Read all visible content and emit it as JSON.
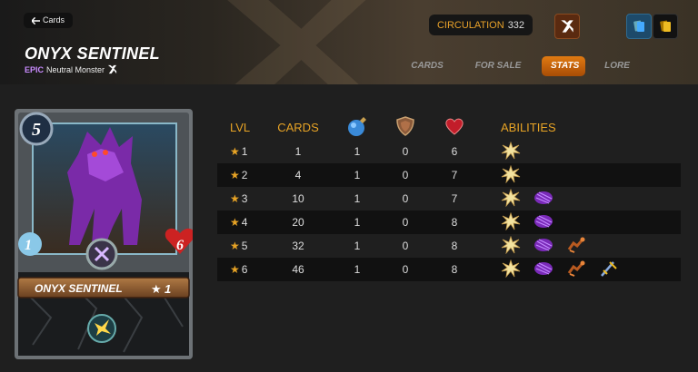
{
  "header": {
    "back_label": "Cards",
    "card_name": "ONYX SENTINEL",
    "rarity": "EPIC",
    "type_label": "Neutral Monster",
    "circulation_label": "CIRCULATION",
    "circulation_value": "332"
  },
  "tabs": [
    {
      "label": "CARDS",
      "active": false
    },
    {
      "label": "FOR SALE",
      "active": false
    },
    {
      "label": "STATS",
      "active": true
    },
    {
      "label": "LORE",
      "active": false
    }
  ],
  "card": {
    "mana": "5",
    "speed": "1",
    "health": "6",
    "name": "ONYX SENTINEL",
    "level": "1"
  },
  "table": {
    "headers": {
      "lvl": "LVL",
      "cards": "CARDS",
      "abilities": "ABILITIES"
    },
    "rows": [
      {
        "lvl": "1",
        "cards": "1",
        "mana": "1",
        "armor": "0",
        "health": "6",
        "abilities": [
          "stun-icon"
        ]
      },
      {
        "lvl": "2",
        "cards": "4",
        "mana": "1",
        "armor": "0",
        "health": "7",
        "abilities": [
          "stun-icon"
        ]
      },
      {
        "lvl": "3",
        "cards": "10",
        "mana": "1",
        "armor": "0",
        "health": "7",
        "abilities": [
          "stun-icon",
          "shield-icon"
        ]
      },
      {
        "lvl": "4",
        "cards": "20",
        "mana": "1",
        "armor": "0",
        "health": "8",
        "abilities": [
          "stun-icon",
          "shield-icon"
        ]
      },
      {
        "lvl": "5",
        "cards": "32",
        "mana": "1",
        "armor": "0",
        "health": "8",
        "abilities": [
          "stun-icon",
          "shield-icon",
          "reach-icon"
        ]
      },
      {
        "lvl": "6",
        "cards": "46",
        "mana": "1",
        "armor": "0",
        "health": "8",
        "abilities": [
          "stun-icon",
          "shield-icon",
          "reach-icon",
          "sword-icon"
        ]
      }
    ]
  },
  "colors": {
    "accent": "#e7a325",
    "tab_active": "#e07a12",
    "epic": "#c98bff"
  }
}
